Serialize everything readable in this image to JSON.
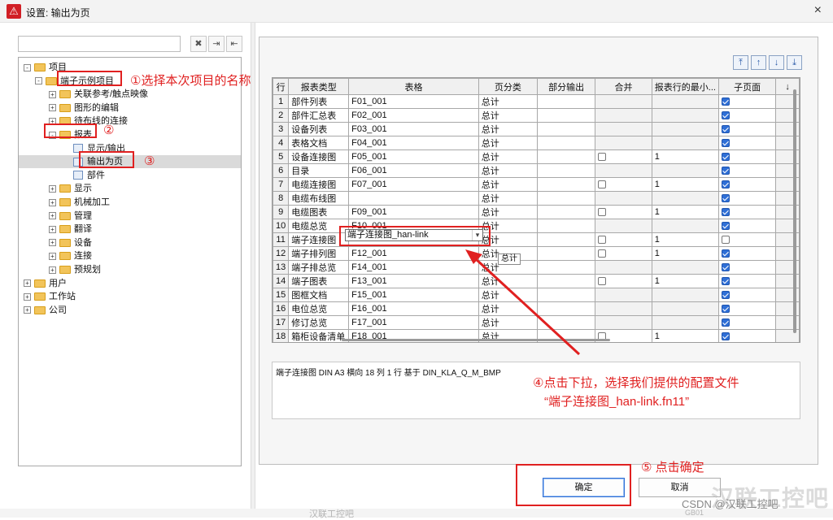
{
  "window": {
    "title": "设置: 输出为页",
    "logo": "app-logo-icon",
    "close": "×"
  },
  "toolbar_icons": [
    "delete-icon",
    "add-icon",
    "import-icon"
  ],
  "tree": [
    {
      "label": "项目",
      "level": 0,
      "expander": "-",
      "icon": "folder"
    },
    {
      "label": "端子示例项目",
      "level": 1,
      "expander": "-",
      "icon": "folder"
    },
    {
      "label": "关联参考/触点映像",
      "level": 2,
      "expander": "+",
      "icon": "folder"
    },
    {
      "label": "图形的编辑",
      "level": 2,
      "expander": "+",
      "icon": "folder"
    },
    {
      "label": "待布线的连接",
      "level": 2,
      "expander": "+",
      "icon": "folder"
    },
    {
      "label": "报表",
      "level": 2,
      "expander": "-",
      "icon": "folder"
    },
    {
      "label": "显示/输出",
      "level": 3,
      "expander": "",
      "icon": "doc"
    },
    {
      "label": "输出为页",
      "level": 3,
      "expander": "",
      "icon": "doc",
      "selected": true
    },
    {
      "label": "部件",
      "level": 3,
      "expander": "",
      "icon": "doc"
    },
    {
      "label": "显示",
      "level": 2,
      "expander": "+",
      "icon": "folder"
    },
    {
      "label": "机械加工",
      "level": 2,
      "expander": "+",
      "icon": "folder"
    },
    {
      "label": "管理",
      "level": 2,
      "expander": "+",
      "icon": "folder"
    },
    {
      "label": "翻译",
      "level": 2,
      "expander": "+",
      "icon": "folder"
    },
    {
      "label": "设备",
      "level": 2,
      "expander": "+",
      "icon": "folder"
    },
    {
      "label": "连接",
      "level": 2,
      "expander": "+",
      "icon": "folder"
    },
    {
      "label": "预规划",
      "level": 2,
      "expander": "+",
      "icon": "folder"
    },
    {
      "label": "用户",
      "level": 0,
      "expander": "+",
      "icon": "folder"
    },
    {
      "label": "工作站",
      "level": 0,
      "expander": "+",
      "icon": "folder"
    },
    {
      "label": "公司",
      "level": 0,
      "expander": "+",
      "icon": "folder"
    }
  ],
  "move_buttons": [
    {
      "name": "move-top-icon",
      "glyph": "⤒"
    },
    {
      "name": "move-up-icon",
      "glyph": "↑"
    },
    {
      "name": "move-down-icon",
      "glyph": "↓"
    },
    {
      "name": "move-bottom-icon",
      "glyph": "⤓"
    }
  ],
  "table": {
    "headers": [
      "行",
      "报表类型",
      "表格",
      "页分类",
      "部分输出",
      "合并",
      "报表行的最小...",
      "子页面",
      "↓"
    ],
    "rows": [
      {
        "n": "1",
        "type": "部件列表",
        "form": "F01_001",
        "cls": "总计",
        "partial": "",
        "merge": null,
        "min": "",
        "sub": true
      },
      {
        "n": "2",
        "type": "部件汇总表",
        "form": "F02_001",
        "cls": "总计",
        "partial": "",
        "merge": null,
        "min": "",
        "sub": true
      },
      {
        "n": "3",
        "type": "设备列表",
        "form": "F03_001",
        "cls": "总计",
        "partial": "",
        "merge": null,
        "min": "",
        "sub": true
      },
      {
        "n": "4",
        "type": "表格文档",
        "form": "F04_001",
        "cls": "总计",
        "partial": "",
        "merge": null,
        "min": "",
        "sub": true
      },
      {
        "n": "5",
        "type": "设备连接图",
        "form": "F05_001",
        "cls": "总计",
        "partial": "",
        "merge": false,
        "min": "1",
        "sub": true
      },
      {
        "n": "6",
        "type": "目录",
        "form": "F06_001",
        "cls": "总计",
        "partial": "",
        "merge": null,
        "min": "",
        "sub": true
      },
      {
        "n": "7",
        "type": "电缆连接图",
        "form": "F07_001",
        "cls": "总计",
        "partial": "",
        "merge": false,
        "min": "1",
        "sub": true
      },
      {
        "n": "8",
        "type": "电缆布线图",
        "form": "",
        "cls": "总计",
        "partial": "",
        "merge": null,
        "min": "",
        "sub": true
      },
      {
        "n": "9",
        "type": "电缆图表",
        "form": "F09_001",
        "cls": "总计",
        "partial": "",
        "merge": false,
        "min": "1",
        "sub": true
      },
      {
        "n": "10",
        "type": "电缆总览",
        "form": "F10_001",
        "cls": "总计",
        "partial": "",
        "merge": null,
        "min": "",
        "sub": true
      },
      {
        "n": "11",
        "type": "端子连接图",
        "form": "",
        "cls": "总计",
        "partial": "",
        "merge": false,
        "min": "1",
        "sub": false
      },
      {
        "n": "12",
        "type": "端子排列图",
        "form": "F12_001",
        "cls": "总计",
        "partial": "",
        "merge": false,
        "min": "1",
        "sub": true
      },
      {
        "n": "13",
        "type": "端子排总览",
        "form": "F14_001",
        "cls": "总计",
        "partial": "",
        "merge": null,
        "min": "",
        "sub": true
      },
      {
        "n": "14",
        "type": "端子图表",
        "form": "F13_001",
        "cls": "总计",
        "partial": "",
        "merge": false,
        "min": "1",
        "sub": true
      },
      {
        "n": "15",
        "type": "图框文档",
        "form": "F15_001",
        "cls": "总计",
        "partial": "",
        "merge": null,
        "min": "",
        "sub": true
      },
      {
        "n": "16",
        "type": "电位总览",
        "form": "F16_001",
        "cls": "总计",
        "partial": "",
        "merge": null,
        "min": "",
        "sub": true
      },
      {
        "n": "17",
        "type": "修订总览",
        "form": "F17_001",
        "cls": "总计",
        "partial": "",
        "merge": null,
        "min": "",
        "sub": true
      },
      {
        "n": "18",
        "type": "箱柜设备清单",
        "form": "F18_001",
        "cls": "总计",
        "partial": "",
        "merge": false,
        "min": "1",
        "sub": true
      }
    ]
  },
  "combo": {
    "value": "端子连接图_han-link",
    "dropdown_icon": "chevron-down-icon"
  },
  "tooltip": "总计",
  "description": "端子连接图 DIN A3 横向 18 列 1 行 基于 DIN_KLA_Q_M_BMP",
  "buttons": {
    "ok": "确定",
    "cancel": "取消"
  },
  "ghost_text": {
    "bottom_left": "汉联工控吧",
    "bottom_right": "GB01"
  },
  "annotations": {
    "a1": "①选择本次项目的名称",
    "a2": "②",
    "a3": "③",
    "a4_line1": "④点击下拉，选择我们提供的配置文件",
    "a4_line2": "“端子连接图_han-link.fn11”",
    "a5": "⑤ 点击确定",
    "color": "#e02020"
  },
  "watermark": {
    "brand": "汉联工控吧",
    "csdn": "CSDN @汉联工控吧"
  }
}
